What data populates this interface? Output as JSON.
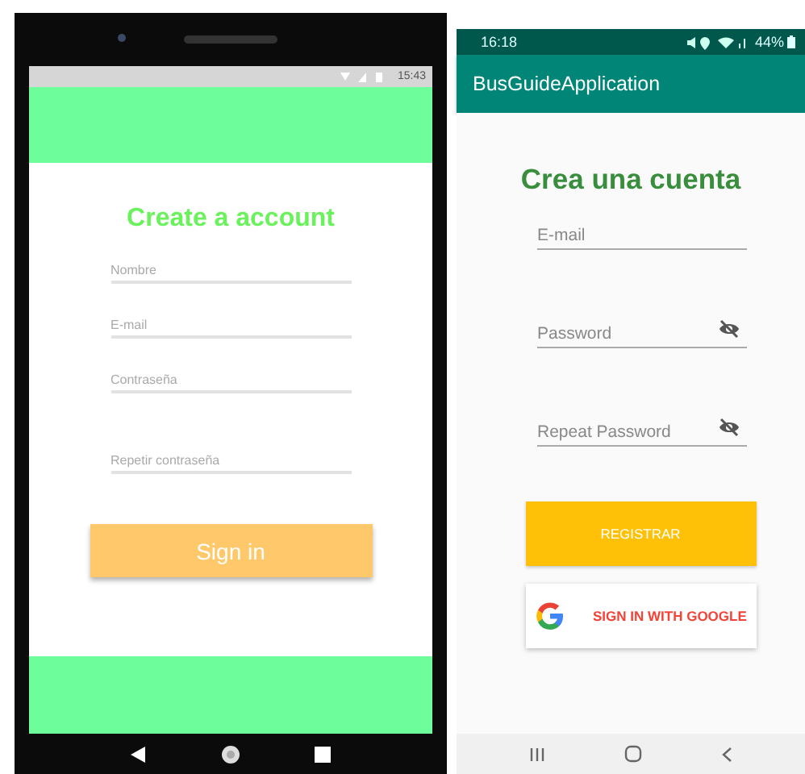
{
  "left_screen": {
    "status_bar": {
      "time": "15:43"
    },
    "title": "Create a account",
    "fields": [
      {
        "placeholder": "Nombre"
      },
      {
        "placeholder": "E-mail"
      },
      {
        "placeholder": "Contraseña"
      },
      {
        "placeholder": "Repetir contraseña"
      }
    ],
    "button": "Sign in"
  },
  "right_screen": {
    "status_bar": {
      "time": "16:18",
      "battery": "44%"
    },
    "app_bar": {
      "title": "BusGuideApplication"
    },
    "title": "Crea una cuenta",
    "fields": [
      {
        "placeholder": "E-mail",
        "kind": "text"
      },
      {
        "placeholder": "Password",
        "kind": "password"
      },
      {
        "placeholder": "Repeat Password",
        "kind": "password"
      }
    ],
    "buttons": [
      {
        "label": "REGISTRAR",
        "kind": "primary"
      },
      {
        "label": "SIGN IN WITH GOOGLE",
        "kind": "google"
      }
    ]
  }
}
